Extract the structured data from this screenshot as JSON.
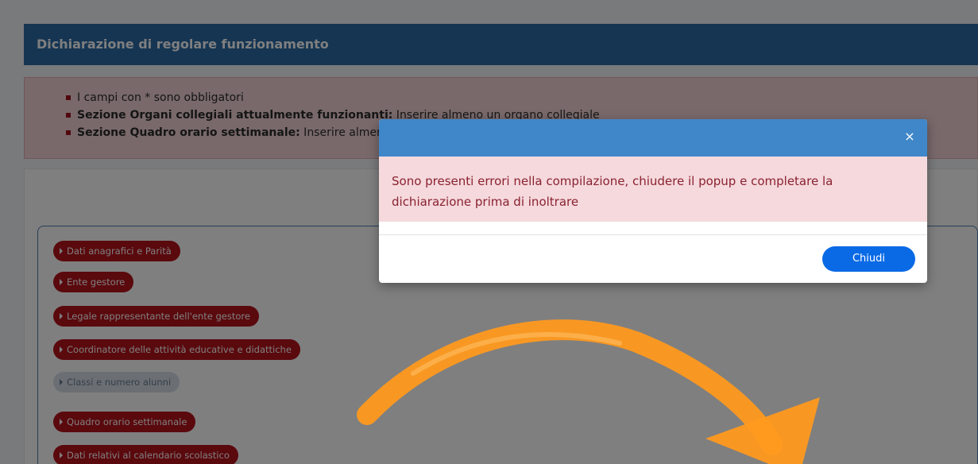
{
  "page": {
    "title": "Dichiarazione di regolare funzionamento",
    "errors": [
      {
        "bold": "",
        "text": "I campi con * sono obbligatori"
      },
      {
        "bold": "Sezione Organi collegiali attualmente funzionanti:",
        "text": " Inserire almeno un organo collegiale"
      },
      {
        "bold": "Sezione Quadro orario settimanale:",
        "text": " Inserire almeno"
      }
    ],
    "sections": [
      {
        "label": "Dati anagrafici e Parità",
        "enabled": true
      },
      {
        "label": "Ente gestore",
        "enabled": true
      },
      {
        "label": "Legale rappresentante dell'ente gestore",
        "enabled": true
      },
      {
        "label": "Coordinatore delle attività educative e didattiche",
        "enabled": true
      },
      {
        "label": "Classi e numero alunni",
        "enabled": false
      },
      {
        "label": "Quadro orario settimanale",
        "enabled": true
      },
      {
        "label": "Dati relativi al calendario scolastico",
        "enabled": true
      }
    ]
  },
  "modal": {
    "close_icon": "×",
    "message": "Sono presenti errori nella compilazione, chiudere il popup e completare la dichiarazione prima di inoltrare",
    "close_label": "Chiudi"
  },
  "colors": {
    "header": "#2a6aa6",
    "modal_header": "#3f87c9",
    "section_button": "#b5121b",
    "primary_button": "#0a6ae6",
    "arrow": "#ff9a1f"
  }
}
